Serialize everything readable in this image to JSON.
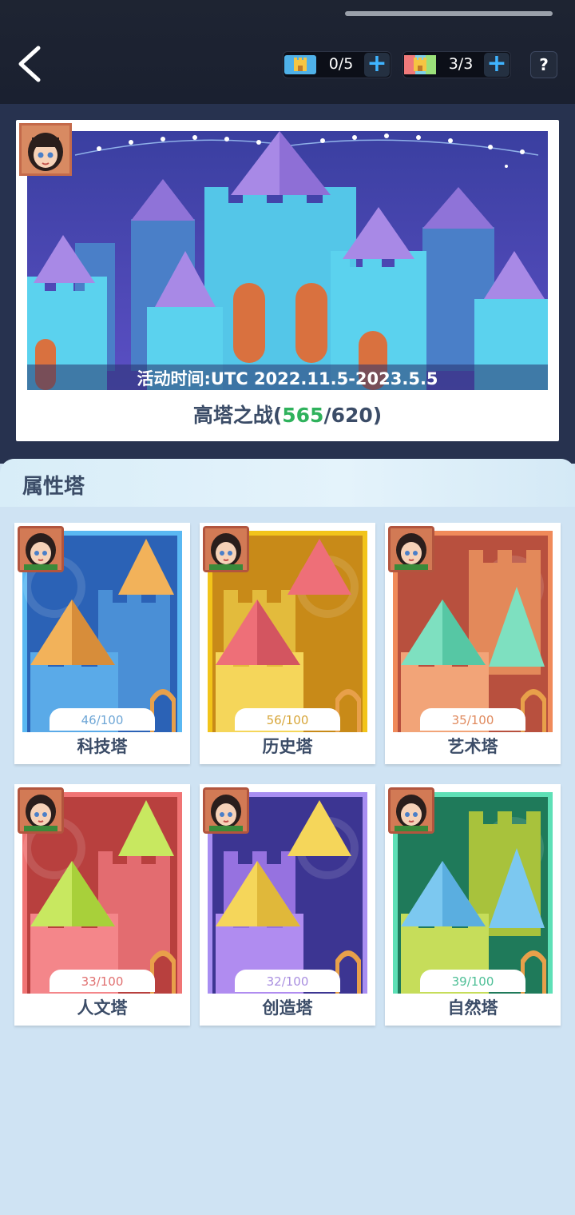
{
  "header": {
    "tickets": [
      {
        "icon": "castle-ticket-icon",
        "count": "0/5"
      },
      {
        "icon": "rainbow-castle-ticket-icon",
        "count": "3/3"
      }
    ],
    "plus_label": "+",
    "help_label": "?"
  },
  "event": {
    "time_text": "活动时间:UTC 2022.11.5-2023.5.5",
    "title_prefix": "高塔之战(",
    "current": "565",
    "separator": "/620)",
    "progress": {
      "current": 565,
      "total": 620
    }
  },
  "attribute_section": {
    "title": "属性塔",
    "towers": [
      {
        "name": "科技塔",
        "progress": "46/100",
        "progress_color": "#6ea6d6"
      },
      {
        "name": "历史塔",
        "progress": "56/100",
        "progress_color": "#d7a63a"
      },
      {
        "name": "艺术塔",
        "progress": "35/100",
        "progress_color": "#e08a5e"
      },
      {
        "name": "人文塔",
        "progress": "33/100",
        "progress_color": "#e07070"
      },
      {
        "name": "创造塔",
        "progress": "32/100",
        "progress_color": "#a98fe0"
      },
      {
        "name": "自然塔",
        "progress": "39/100",
        "progress_color": "#4dbf96"
      }
    ]
  },
  "colors": {
    "topbar": "#1e2432",
    "accent_plus": "#3fb4ff",
    "score_green": "#2fb25c",
    "text_dark": "#3b4c67"
  }
}
